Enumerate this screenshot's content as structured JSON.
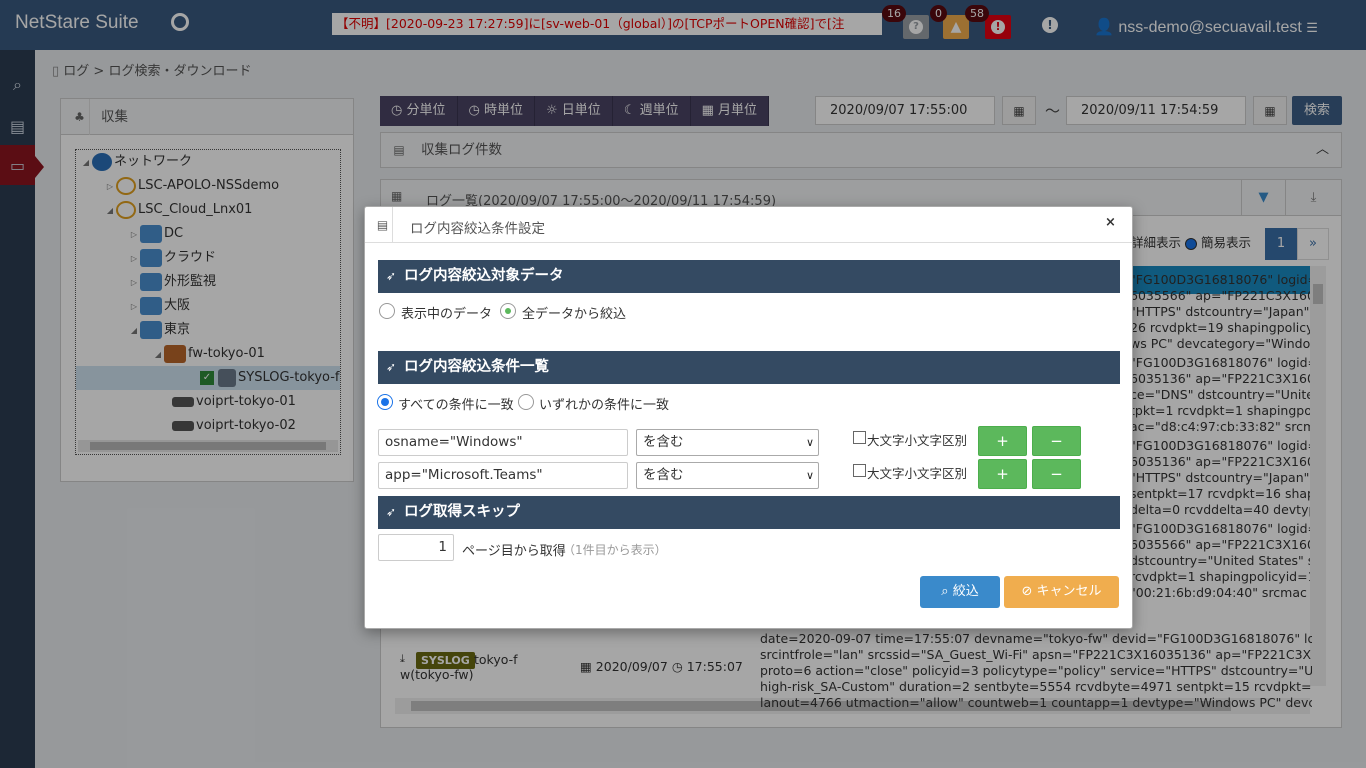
{
  "header": {
    "app_title": "NetStare Suite",
    "ticker": "【不明】[2020-09-23 17:27:59]に[sv-web-01（global）]の[TCPポートOPEN確認]で[注",
    "counts": {
      "unknown": "16",
      "warning": "0",
      "critical": "58"
    },
    "user": "nss-demo@secuavail.test"
  },
  "breadcrumb": "ログ > ログ検索・ダウンロード",
  "tree_panel": {
    "title": "収集",
    "nodes": [
      "ネットワーク",
      "LSC-APOLO-NSSdemo",
      "LSC_Cloud_Lnx01",
      "DC",
      "クラウド",
      "外形監視",
      "大阪",
      "東京",
      "fw-tokyo-01",
      "SYSLOG-tokyo-f",
      "voiprt-tokyo-01",
      "voiprt-tokyo-02"
    ]
  },
  "toolbar": {
    "units": [
      "分単位",
      "時単位",
      "日単位",
      "週単位",
      "月単位"
    ],
    "date_from": "2020/09/07 17:55:00",
    "tilde": "～",
    "date_to": "2020/09/11 17:54:59",
    "search": "検索"
  },
  "panels": {
    "count_title": "収集ログ件数",
    "list_title": "ログ一覧(2020/09/07 17:55:00～2020/09/11 17:54:59)",
    "view_detail": "詳細表示",
    "view_simple": "簡易表示",
    "page": "1",
    "next": "»"
  },
  "log_snippets": [
    "\"FG100D3G16818076\" logid=\n6035566\" ap=\"FP221C3X1603\n\"HTTPS\" dstcountry=\"Japan\" s\n26 rcvdpkt=19 shapingpolicyid\nws PC\" devcategory=\"Windows",
    "\"FG100D3G16818076\" logid=\n6035136\" ap=\"FP221C3X1603\nce=\"DNS\" dstcountry=\"United\ntpkt=1 rcvdpkt=1 shapingpolic\nac=\"d8:c4:97:cb:33:82\" srcma",
    "\"FG100D3G16818076\" logid=\n6035136\" ap=\"FP221C3X1603\n\"HTTPS\" dstcountry=\"Japan\" s\nsentpkt=17 rcvdpkt=16 shapi\ndelta=0 rcvddelta=40 devtype",
    "\"FG100D3G16818076\" logid=\n6035566\" ap=\"FP221C3X1603\ndstcountry=\"United States\" sr\nrcvdpkt=1 shapingpolicyid=1 s\n\"00:21:6b:d9:04:40\" srcmac"
  ],
  "log_row": {
    "badge": "SYSLOG",
    "source": "tokyo-fw(tokyo-fw)",
    "date": "2020/09/07",
    "time": "17:55:07",
    "text": "date=2020-09-07 time=17:55:07 devname=\"tokyo-fw\" devid=\"FG100D3G16818076\" logid=\nsrcintfrole=\"lan\" srcssid=\"SA_Guest_Wi-Fi\" apsn=\"FP221C3X16035136\" ap=\"FP221C3X1603\nproto=6 action=\"close\" policyid=3 policytype=\"policy\" service=\"HTTPS\" dstcountry=\"United S\nhigh-risk_SA-Custom\" duration=2 sentbyte=5554 rcvdbyte=4971 sentpkt=15 rcvdpkt=13 shap\nlanout=4766 utmaction=\"allow\" countweb=1 countapp=1 devtype=\"Windows PC\" devcategor"
  },
  "modal": {
    "title": "ログ内容絞込条件設定",
    "close": "×",
    "section1": "ログ内容絞込対象データ",
    "scope_current": "表示中のデータ",
    "scope_all": "全データから絞込",
    "section2": "ログ内容絞込条件一覧",
    "match_all": "すべての条件に一致",
    "match_any": "いずれかの条件に一致",
    "conditions": [
      {
        "value": "osname=\"Windows\"",
        "op": "を含む",
        "case_label": "大文字小文字区別"
      },
      {
        "value": "app=\"Microsoft.Teams\"",
        "op": "を含む",
        "case_label": "大文字小文字区別"
      }
    ],
    "plus": "+",
    "minus": "−",
    "section3": "ログ取得スキップ",
    "skip_value": "1",
    "skip_label": "ページ目から取得",
    "skip_hint": "（1件目から表示）",
    "filter_btn": "絞込",
    "cancel_btn": "キャンセル"
  },
  "colors": {
    "header": "#3a5a80",
    "sidebar_active": "#8c1420",
    "section": "#344a62",
    "primary": "#3a8acb",
    "warning": "#f0ad4e",
    "success": "#5cb85c"
  }
}
